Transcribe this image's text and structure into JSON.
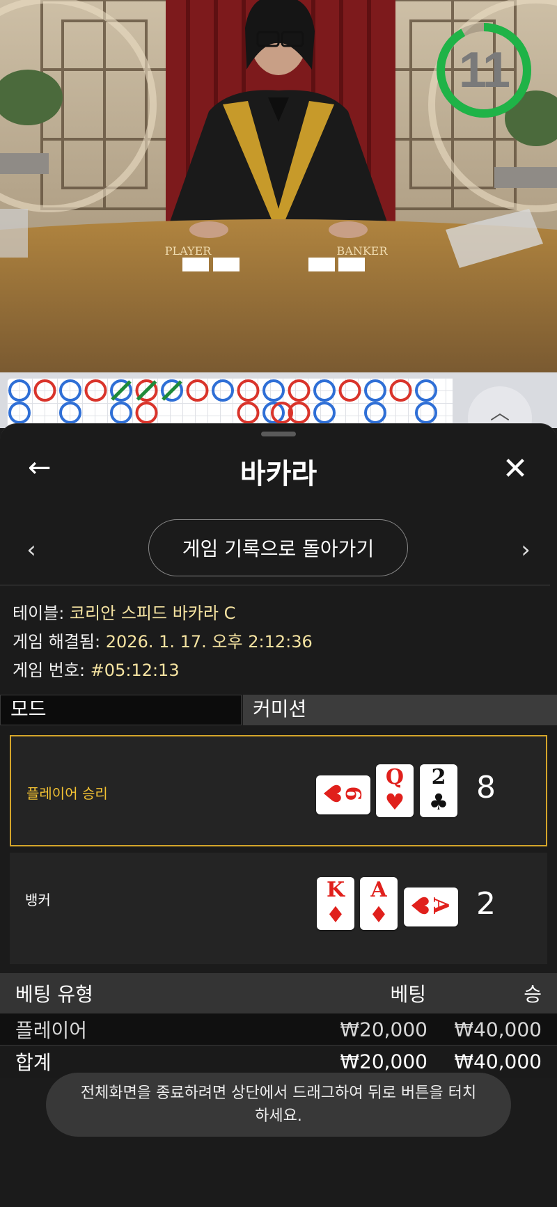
{
  "video": {
    "countdown": "11",
    "countdown_fraction": 0.92,
    "table_labels": {
      "player": "PLAYER",
      "banker": "BANKER"
    }
  },
  "road": {
    "row1": [
      "B",
      "R",
      "B",
      "R",
      "B-slash",
      "R-slash",
      "B-slash",
      "R",
      "B",
      "R",
      "B",
      "R",
      "B",
      "R",
      "B",
      "R",
      "B"
    ],
    "row2": [
      "B",
      "",
      "B",
      "",
      "B",
      "R",
      "",
      "",
      "",
      "R",
      "B-R",
      "R",
      "B",
      "",
      "B",
      "",
      "B"
    ]
  },
  "header": {
    "title": "바카라",
    "back_icon": "←",
    "close_icon": "✕"
  },
  "nav": {
    "prev_icon": "‹",
    "next_icon": "›",
    "back_to_history": "게임 기록으로 돌아가기"
  },
  "info": {
    "table_label": "테이블:",
    "table_value": "코리안 스피드 바카라 C",
    "resolved_label": "게임 해결됨:",
    "resolved_value": "2026. 1. 17. 오후 2:12:36",
    "game_no_label": "게임 번호:",
    "game_no_value": "#05:12:13"
  },
  "tabs": {
    "mode": "모드",
    "commission": "커미션"
  },
  "results": {
    "player": {
      "label": "플레이어 승리",
      "score": "8",
      "cards": [
        {
          "rank": "6",
          "suit": "♥",
          "orientation": "horizontal"
        },
        {
          "rank": "Q",
          "suit": "♥",
          "orientation": "vertical"
        },
        {
          "rank": "2",
          "suit": "♣",
          "orientation": "vertical"
        }
      ]
    },
    "banker": {
      "label": "뱅커",
      "score": "2",
      "cards": [
        {
          "rank": "K",
          "suit": "♦",
          "orientation": "vertical"
        },
        {
          "rank": "A",
          "suit": "♦",
          "orientation": "vertical"
        },
        {
          "rank": "A",
          "suit": "♥",
          "orientation": "horizontal"
        }
      ]
    }
  },
  "bets": {
    "headers": {
      "type": "베팅 유형",
      "bet": "베팅",
      "win": "승"
    },
    "rows": [
      {
        "type": "플레이어",
        "bet": "₩20,000",
        "win": "₩40,000"
      }
    ],
    "total": {
      "type": "합계",
      "bet": "₩20,000",
      "win": "₩40,000"
    }
  },
  "toast": "전체화면을 종료하려면 상단에서 드래그하여 뒤로 버튼을 터치하세요.",
  "colors": {
    "accent_gold": "#d4a52a",
    "win_label": "#f3c233",
    "info_value": "#f5e3a1",
    "timer_green": "#1fb347",
    "banker_red": "#d9342b",
    "player_blue": "#2f6fd6"
  }
}
